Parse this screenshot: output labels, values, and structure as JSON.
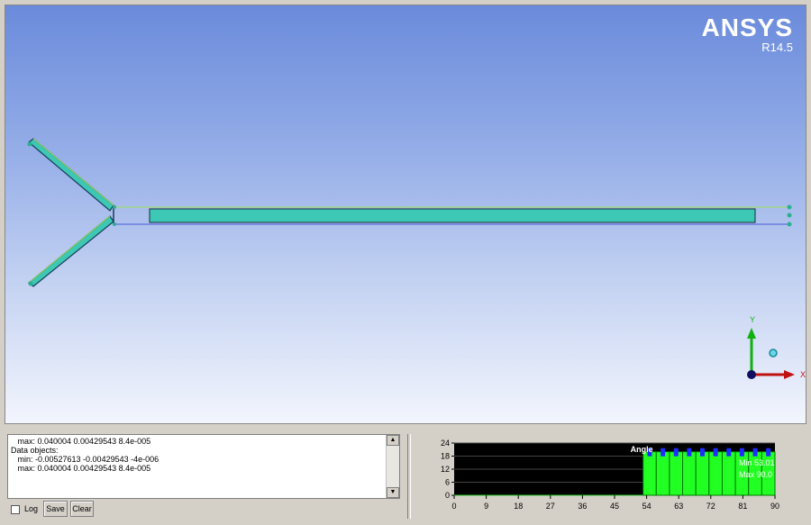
{
  "brand": {
    "name": "ANSYS",
    "version": "R14.5"
  },
  "triad": {
    "y_label": "Y",
    "x_label": "X"
  },
  "console": {
    "lines": [
      "   max: 0.040004 0.00429543 8.4e-005",
      "Data objects:",
      "   min: -0.00527613 -0.00429543 -4e-006",
      "   max: 0.040004 0.00429543 8.4e-005"
    ],
    "scroll_up": "▲",
    "scroll_down": "▼"
  },
  "controls": {
    "log_label": "Log",
    "save_label": "Save",
    "clear_label": "Clear"
  },
  "colors": {
    "mesh_fill": "#3cc8b4",
    "histogram_bar": "#22ff22",
    "histogram_bg": "#000000",
    "marker": "#1f2bff"
  },
  "chart_data": {
    "type": "bar",
    "title": "Angle",
    "x_ticks": [
      0,
      9,
      18,
      27,
      36,
      45,
      54,
      63,
      72,
      81,
      90
    ],
    "y_ticks": [
      0,
      6,
      12,
      18,
      24
    ],
    "xlim": [
      0,
      90
    ],
    "ylim": [
      0,
      24
    ],
    "bins": [
      {
        "x0": 0,
        "x1": 53.01,
        "value": 0
      },
      {
        "x0": 53.01,
        "x1": 56.7,
        "value": 20
      },
      {
        "x0": 56.7,
        "x1": 60.4,
        "value": 20
      },
      {
        "x0": 60.4,
        "x1": 64.1,
        "value": 20
      },
      {
        "x0": 64.1,
        "x1": 67.8,
        "value": 20
      },
      {
        "x0": 67.8,
        "x1": 71.5,
        "value": 20
      },
      {
        "x0": 71.5,
        "x1": 75.2,
        "value": 20
      },
      {
        "x0": 75.2,
        "x1": 78.9,
        "value": 20
      },
      {
        "x0": 78.9,
        "x1": 82.6,
        "value": 20
      },
      {
        "x0": 82.6,
        "x1": 86.3,
        "value": 20
      },
      {
        "x0": 86.3,
        "x1": 90.0,
        "value": 20
      }
    ],
    "min_label": "Min 53.01",
    "max_label": "Max 90.0",
    "grid": true
  }
}
